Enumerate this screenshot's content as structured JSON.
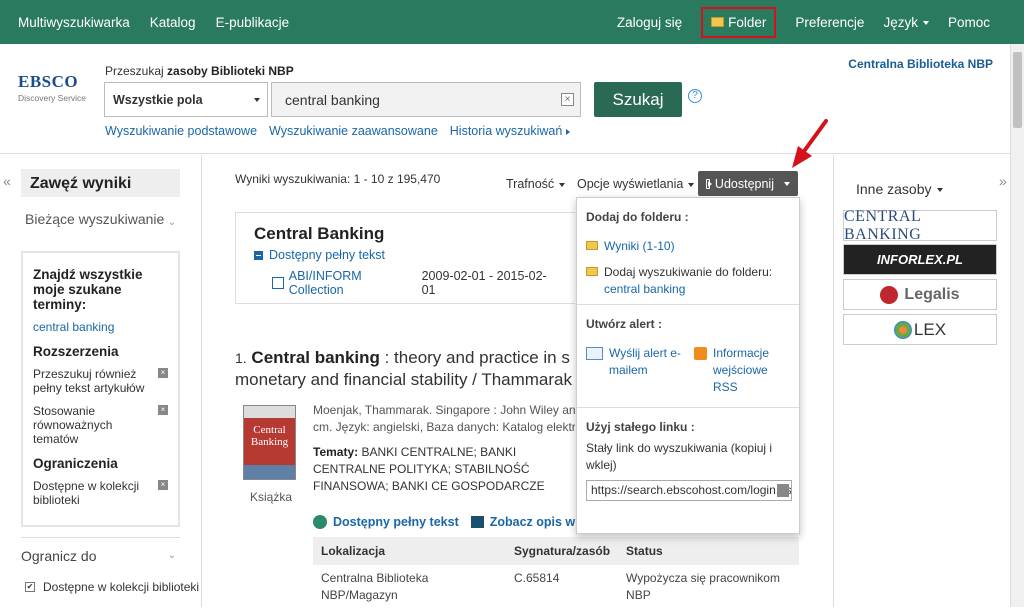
{
  "topnav": {
    "left": [
      "Multiwyszukiwarka",
      "Katalog",
      "E-publikacje"
    ],
    "login": "Zaloguj się",
    "folder": "Folder",
    "preferences": "Preferencje",
    "language": "Język",
    "help": "Pomoc"
  },
  "logo": {
    "brand": "EBSCO",
    "sub": "Discovery Service"
  },
  "search": {
    "scope_prefix": "Przeszukaj",
    "scope_bold": "zasoby Biblioteki NBP",
    "field": "Wszystkie pola",
    "query": "central banking",
    "button": "Szukaj",
    "help": "?",
    "links": [
      "Wyszukiwanie podstawowe",
      "Wyszukiwanie zaawansowane",
      "Historia wyszukiwań"
    ]
  },
  "institution": "Centralna Biblioteka NBP",
  "left": {
    "title": "Zawęź wyniki",
    "current_search": "Bieżące wyszukiwanie",
    "find_all": "Znajdź wszystkie moje szukane terminy:",
    "term": "central banking",
    "expanders_hd": "Rozszerzenia",
    "expanders": [
      "Przeszukuj również pełny tekst artykułów",
      "Stosowanie równoważnych tematów"
    ],
    "limiters_hd": "Ograniczenia",
    "limiters": [
      "Dostępne w kolekcji biblioteki"
    ],
    "limit_to": "Ogranicz do",
    "limit_cb": "Dostępne w kolekcji biblioteki"
  },
  "results": {
    "count": "Wyniki wyszukiwania: 1 - 10 z 195,470",
    "sort": "Trafność",
    "options": "Opcje wyświetlania",
    "share": "Udostępnij"
  },
  "publication": {
    "title": "Central Banking",
    "fulltext": "Dostępny pełny tekst",
    "db_link": "ABI/INFORM Collection",
    "db_dates": "2009-02-01 - 2015-02-01"
  },
  "record": {
    "num": "1.",
    "title_bold": "Central banking",
    "title_rest": " : theory and practice in s",
    "title_line2": "monetary and financial stability / Thammarak",
    "cover_text": "Central Banking",
    "type": "Książka",
    "meta1": "Moenjak, Thammarak. Singapore : John Wiley and",
    "meta2": "cm. Język: angielski, Baza danych: Katalog elektron",
    "subj_label": "Tematy:",
    "subjects": " BANKI CENTRALNE; BANKI CENTRALNE POLITYKA; STABILNOŚĆ FINANSOWA; BANKI CE GOSPODARCZE",
    "ft_link": "Dostępny pełny tekst",
    "detail_link": "Zobacz opis w k",
    "holdings": {
      "headers": [
        "Lokalizacja",
        "Sygnatura/zasób",
        "Status"
      ],
      "rows": [
        [
          "Centralna Biblioteka NBP/Magazyn",
          "C.65814",
          "Wypożycza się pracownikom NBP"
        ]
      ]
    }
  },
  "share_menu": {
    "folder_hd": "Dodaj do folderu :",
    "results_link": "Wyniki (1-10)",
    "add_search": "Dodaj wyszukiwanie do folderu:",
    "add_search_term": "central banking",
    "alert_hd": "Utwórz alert :",
    "email_alert": "Wyślij alert e-mailem",
    "rss": "Informacje wejściowe RSS",
    "permalink_hd": "Użyj stałego linku :",
    "permalink_desc": "Stały link do wyszukiwania (kopiuj i wklej)",
    "permalink_url": "https://search.ebscohost.com/login.asp"
  },
  "right": {
    "other_sources": "Inne zasoby",
    "banners": [
      "CENTRAL BANKING",
      "INFORLEX.PL",
      "Legalis",
      "LEX"
    ]
  },
  "colors": {
    "topbar": "#2a7a5f",
    "search_button": "#2a6a55",
    "link": "#1a66a8",
    "highlight": "#d4121b"
  }
}
